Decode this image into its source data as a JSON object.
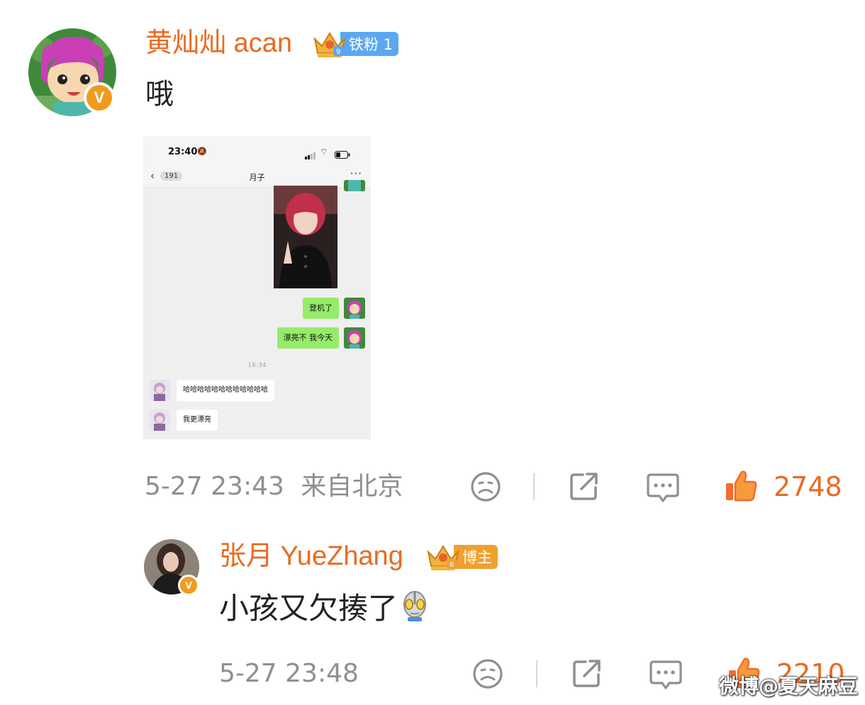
{
  "colors": {
    "accent": "#e86b22",
    "verified": "#f29a1a",
    "iron_fan_badge": "#5aa8f2",
    "blogger_badge": "#f0a030",
    "meta_grey": "#8f8f8f",
    "wechat_green": "#95ec69"
  },
  "comment": {
    "username": "黄灿灿 acan",
    "fan_badge": "铁粉 1",
    "text": "哦",
    "timestamp": "5-27 23:43",
    "location": "来自北京",
    "likes": "2748",
    "icons": [
      "emoji-icon",
      "share-icon",
      "comment-icon",
      "thumbs-up-icon"
    ]
  },
  "screenshot": {
    "time": "23:40",
    "back_count": "191",
    "chat_title": "月子",
    "msg_sent_1": "登机了",
    "msg_sent_2": "漂亮不 我今天",
    "timestamp": "16:34",
    "msg_recv_1": "哈哈哈哈哈哈哈哈哈哈哈哈",
    "msg_recv_2": "我更漂亮"
  },
  "reply": {
    "username": "张月 YueZhang",
    "badge": "博主",
    "text": "小孩又欠揍了",
    "timestamp": "5-27 23:48",
    "likes": "2210",
    "icons": [
      "emoji-icon",
      "share-icon",
      "comment-icon",
      "thumbs-up-icon",
      "ultraman-emoji-icon"
    ]
  },
  "watermark": "微博@夏天麻豆"
}
